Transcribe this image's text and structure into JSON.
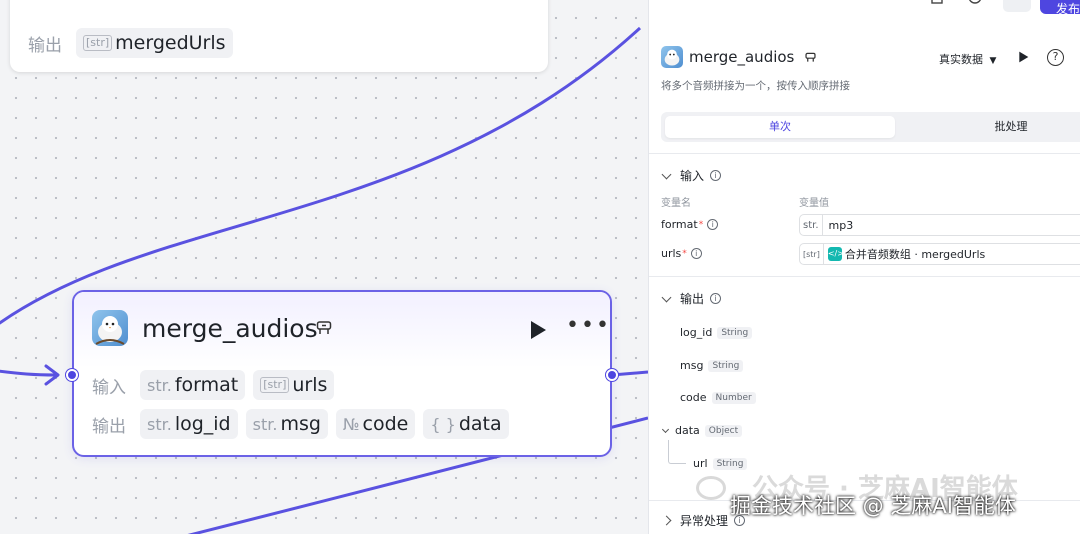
{
  "canvas": {
    "prev_node": {
      "output_label": "输出",
      "outputs": [
        {
          "type": "[str]",
          "name": "mergedUrls"
        }
      ]
    },
    "node": {
      "title": "merge_audios",
      "input_label": "输入",
      "output_label": "输出",
      "inputs": [
        {
          "type": "str.",
          "name": "format"
        },
        {
          "type": "[str]",
          "name": "urls"
        }
      ],
      "outputs": [
        {
          "type": "str.",
          "name": "log_id"
        },
        {
          "type": "str.",
          "name": "msg"
        },
        {
          "type": "№",
          "name": "code"
        },
        {
          "type": "{ }",
          "name": "data"
        }
      ]
    }
  },
  "panel": {
    "title": "merge_audios",
    "mode": "真实数据",
    "description": "将多个音频拼接为一个，按传入顺序拼接",
    "tabs": [
      "单次",
      "批处理"
    ],
    "input_section": "输入",
    "col_name": "变量名",
    "col_value": "变量值",
    "inputs": [
      {
        "name": "format",
        "type": "str.",
        "value": "mp3"
      },
      {
        "name": "urls",
        "type": "[str]",
        "value": "合并音频数组 · mergedUrls"
      }
    ],
    "output_section": "输出",
    "outputs": [
      {
        "name": "log_id",
        "type": "String"
      },
      {
        "name": "msg",
        "type": "String"
      },
      {
        "name": "code",
        "type": "Number"
      },
      {
        "name": "data",
        "type": "Object"
      },
      {
        "name": "url",
        "type": "String"
      }
    ],
    "exception_section": "异常处理"
  },
  "topbar": {
    "publish": "发布"
  },
  "watermarks": {
    "line1": "公众号 · 芝麻AI智能体",
    "line2": "掘金技术社区 @ 芝麻AI智能体"
  },
  "colors": {
    "accent": "#4e46e0",
    "edge": "#5a52e0",
    "teal": "#13b8b0"
  }
}
